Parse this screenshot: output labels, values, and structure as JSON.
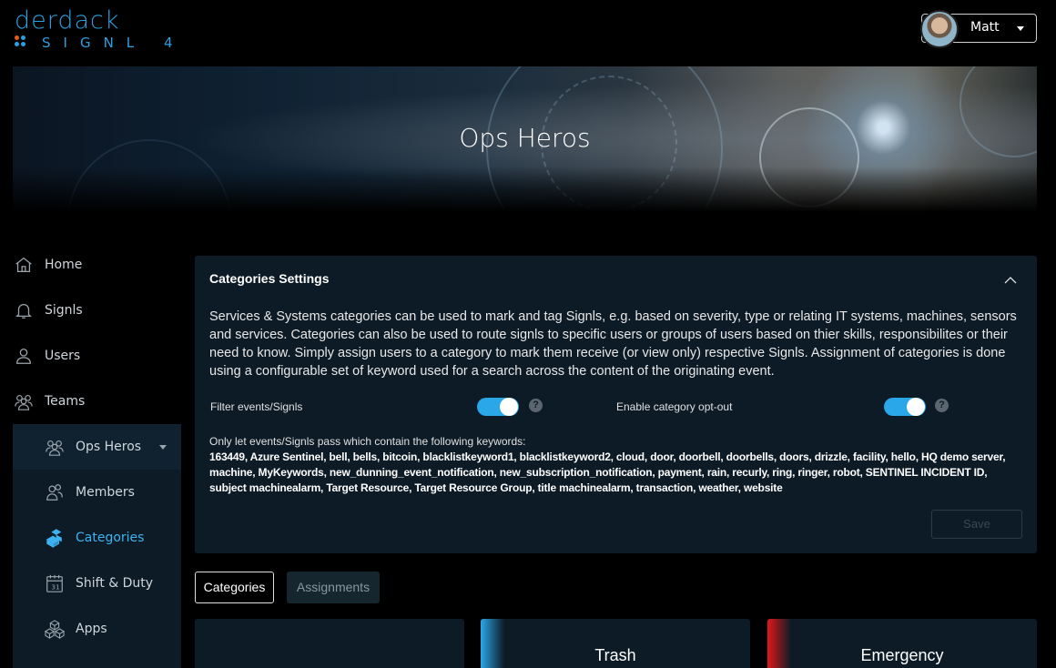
{
  "brand": {
    "word": "Derdack",
    "sub": "SIGNL",
    "version": "4"
  },
  "user": {
    "name": "Matt"
  },
  "banner": {
    "title": "Ops Heros"
  },
  "sidebar": {
    "items": [
      {
        "label": "Home",
        "icon": "home-icon"
      },
      {
        "label": "Signls",
        "icon": "bell-icon"
      },
      {
        "label": "Users",
        "icon": "user-icon"
      },
      {
        "label": "Teams",
        "icon": "teams-icon"
      }
    ],
    "team": {
      "label": "Ops Heros",
      "icon": "team-icon"
    },
    "sub_items": [
      {
        "label": "Members",
        "icon": "members-icon"
      },
      {
        "label": "Categories",
        "icon": "categories-icon",
        "active": true
      },
      {
        "label": "Shift & Duty",
        "icon": "calendar-icon"
      },
      {
        "label": "Apps",
        "icon": "apps-icon"
      }
    ]
  },
  "settings": {
    "title": "Categories Settings",
    "description": "Services & Systems categories can be used to mark and tag Signls, e.g. based on severity, type or relating IT systems, machines, sensors and services. Categories can also be used to route signls to specific users or groups of users based on thier skills, responsibilites or their need to know. Simply assign users to a category to mark them receive (or view only) respective Signls. Assignment of categories is done using a configurable set of keyword used for a search across the content of the originating event.",
    "filter_label": "Filter events/Signls",
    "filter_on": true,
    "optout_label": "Enable category opt-out",
    "optout_on": true,
    "help_glyph": "?",
    "keywords_label": "Only let events/Signls pass which contain the following keywords:",
    "keywords": "163449, Azure Sentinel, bell, bells, bitcoin, blacklistkeyword1, blacklistkeyword2, cloud, door, doorbell, doorbells, doors, drizzle, facility, hello, HQ demo server, machine, MyKeywords, new_dunning_event_notification, new_subscription_notification, payment, rain, recurly, ring, ringer, robot, SENTINEL INCIDENT ID, subject machinealarm, Target Resource, Target Resource Group, title machinealarm, transaction, weather, website",
    "save_label": "Save"
  },
  "tabs": [
    {
      "label": "Categories",
      "active": true
    },
    {
      "label": "Assignments",
      "active": false
    }
  ],
  "cards": [
    {
      "title": "",
      "color": ""
    },
    {
      "title": "Trash",
      "color": "#2aa7e8"
    },
    {
      "title": "Emergency",
      "color": "#e01818"
    }
  ],
  "colors": {
    "accent": "#2aa7e8",
    "panel": "#0d1b26",
    "emergency": "#e01818"
  }
}
